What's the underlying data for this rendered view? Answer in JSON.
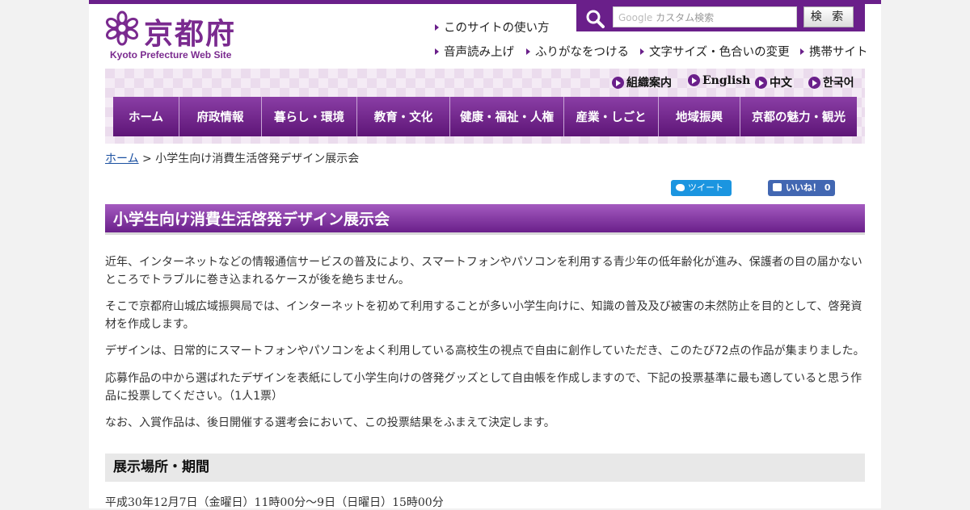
{
  "logo": {
    "title": "京都府",
    "subtitle": "Kyoto Prefecture Web Site"
  },
  "util_links": {
    "how_to_use": "このサイトの使い方",
    "voice": "音声読み上げ",
    "furigana": "ふりがなをつける",
    "text_size": "文字サイズ・色合いの変更",
    "mobile": "携帯サイト"
  },
  "search": {
    "placeholder": "カスタム検索",
    "google": "Google",
    "button": "検 索"
  },
  "languages": [
    {
      "label": "組織案内"
    },
    {
      "label": "English"
    },
    {
      "label": "中文"
    },
    {
      "label": "한국어"
    }
  ],
  "nav": [
    {
      "label": "ホーム"
    },
    {
      "label": "府政情報"
    },
    {
      "label": "暮らし・環境"
    },
    {
      "label": "教育・文化"
    },
    {
      "label": "健康・福祉・人権"
    },
    {
      "label": "産業・しごと"
    },
    {
      "label": "地域振興"
    },
    {
      "label": "京都の魅力・観光"
    }
  ],
  "breadcrumb": {
    "home": "ホーム",
    "separator": " > ",
    "current": "小学生向け消費生活啓発デザイン展示会"
  },
  "social": {
    "tweet": "ツイート",
    "like": "いいね！ 0"
  },
  "page": {
    "title": "小学生向け消費生活啓発デザイン展示会",
    "paragraphs": [
      "近年、インターネットなどの情報通信サービスの普及により、スマートフォンやパソコンを利用する青少年の低年齢化が進み、保護者の目の届かないところでトラブルに巻き込まれるケースが後を絶ちません。",
      "そこで京都府山城広域振興局では、インターネットを初めて利用することが多い小学生向けに、知識の普及及び被害の未然防止を目的として、啓発資材を作成します。",
      "デザインは、日常的にスマートフォンやパソコンをよく利用している高校生の視点で自由に創作していただき、このたび72点の作品が集まりました。",
      "応募作品の中から選ばれたデザインを表紙にして小学生向けの啓発グッズとして自由帳を作成しますので、下記の投票基準に最も適していると思う作品に投票してください。（1人1票）",
      "なお、入賞作品は、後日開催する選考会において、この投票結果をふまえて決定します。"
    ],
    "section_title": "展示場所・期間",
    "period": "平成30年12月7日（金曜日）11時00分～9日（日曜日）15時00分"
  },
  "colors": {
    "brand": "#6a1f8a",
    "link": "#1a4fa0"
  }
}
